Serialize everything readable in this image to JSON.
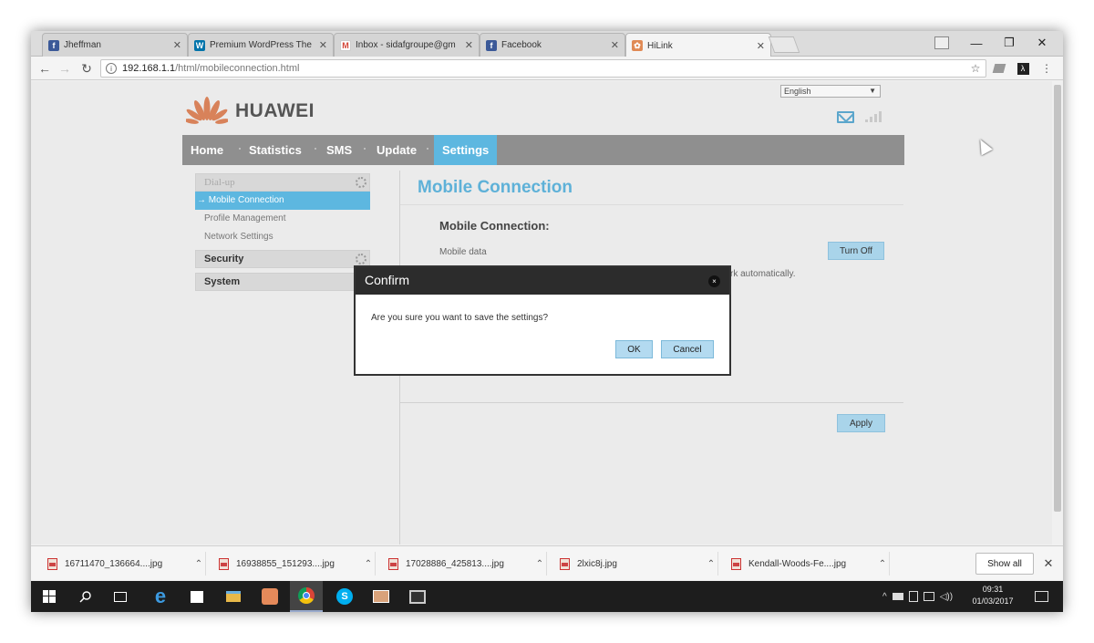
{
  "browser": {
    "tabs": [
      {
        "label": "Jheffman",
        "icon": "facebook-icon",
        "color": "#3b5998"
      },
      {
        "label": "Premium WordPress The",
        "icon": "wordpress-icon",
        "color": "#0073aa"
      },
      {
        "label": "Inbox - sidafgroupe@gm",
        "icon": "gmail-icon",
        "color": "#d44638"
      },
      {
        "label": "Facebook",
        "icon": "facebook-icon",
        "color": "#3b5998"
      },
      {
        "label": "HiLink",
        "icon": "huawei-icon",
        "color": "#c9643b"
      }
    ],
    "close_glyph": "✕",
    "url_host": "192.168.1.1",
    "url_path": "/html/mobileconnection.html"
  },
  "hilink": {
    "language": "English",
    "brand": "HUAWEI",
    "nav": [
      "Home",
      "Statistics",
      "SMS",
      "Update",
      "Settings"
    ],
    "sidebar": {
      "dialup": "Dial-up",
      "items": [
        "Mobile Connection",
        "Profile Management",
        "Network Settings"
      ],
      "security": "Security",
      "system": "System"
    },
    "page_title": "Mobile Connection",
    "section_title": "Mobile Connection:",
    "mobile_data_label": "Mobile data",
    "turn_off_label": "Turn Off",
    "auto_note": "rk automatically.",
    "apply_label": "Apply"
  },
  "dialog": {
    "title": "Confirm",
    "close": "×",
    "message": "Are you sure you want to save the settings?",
    "ok": "OK",
    "cancel": "Cancel"
  },
  "downloads": {
    "files": [
      "16711470_136664....jpg",
      "16938855_151293....jpg",
      "17028886_425813....jpg",
      "2lxic8j.jpg",
      "Kendall-Woods-Fe....jpg"
    ],
    "show_all": "Show all"
  },
  "taskbar": {
    "time": "09:31",
    "date": "01/03/2017"
  },
  "colors": {
    "accent": "#5db7e0",
    "nav_bg": "#8f8f8f",
    "dialog_header": "#2c2c2c"
  }
}
